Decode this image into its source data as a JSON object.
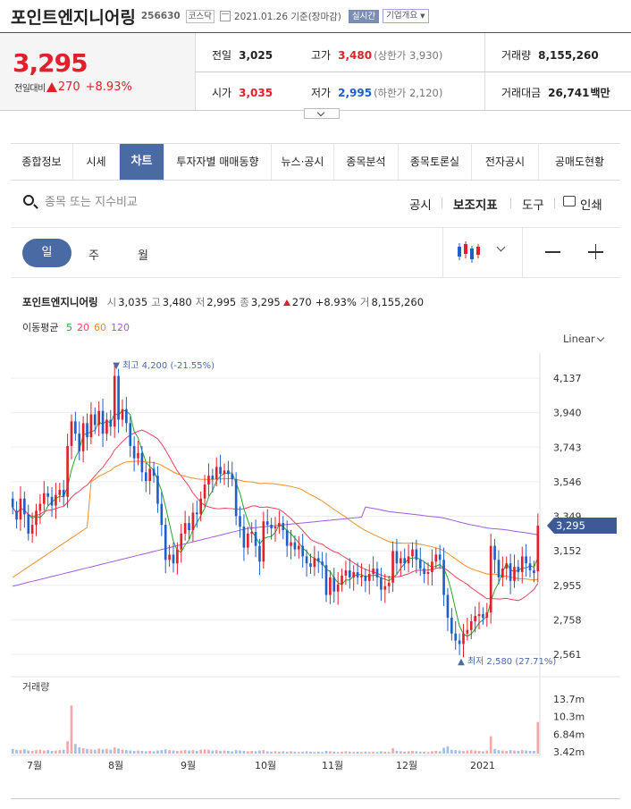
{
  "header": {
    "name": "포인트엔지니어링",
    "code": "256630",
    "market": "코스닥",
    "date": "2021.01.26",
    "basis": "기준(장마감)",
    "realtime": "실시간",
    "company": "기업개요"
  },
  "price": {
    "current": "3,295",
    "change_label": "전일대비",
    "change": "270",
    "change_pct": "+8.93%",
    "color": "#e0202a"
  },
  "stats": {
    "prev_label": "전일",
    "prev": "3,025",
    "high_label": "고가",
    "high": "3,480",
    "upper_limit": "(상한가 3,930)",
    "volume_label": "거래량",
    "volume": "8,155,260",
    "open_label": "시가",
    "open": "3,035",
    "low_label": "저가",
    "low": "2,995",
    "lower_limit": "(하한가 2,120)",
    "amount_label": "거래대금",
    "amount": "26,741",
    "amount_unit": "백만"
  },
  "tabs": [
    "종합정보",
    "시세",
    "차트",
    "투자자별 매매동향",
    "뉴스·공시",
    "종목분석",
    "종목토론실",
    "전자공시",
    "공매도현황"
  ],
  "active_tab": 2,
  "search": {
    "placeholder": "종목 또는 지수비교"
  },
  "tools": {
    "notice": "공시",
    "indicator": "보조지표",
    "tool": "도구",
    "print": "인쇄"
  },
  "periods": {
    "day": "일",
    "week": "주",
    "month": "월"
  },
  "info": {
    "name": "포인트엔지니어링",
    "open_k": "시",
    "open_v": "3,035",
    "high_k": "고",
    "high_v": "3,480",
    "low_k": "저",
    "low_v": "2,995",
    "close_k": "종",
    "close_v": "3,295",
    "chg_v": "270",
    "pct_v": "+8.93%",
    "vol_k": "거",
    "vol_v": "8,155,260"
  },
  "ma": {
    "label": "이동평균",
    "items": [
      {
        "label": "5",
        "color": "#27a52a"
      },
      {
        "label": "20",
        "color": "#f0435c"
      },
      {
        "label": "60",
        "color": "#f0902a"
      },
      {
        "label": "120",
        "color": "#a05be0"
      }
    ]
  },
  "scale": "Linear",
  "price_tag": "3,295",
  "volume_label": "거래량",
  "chart_data": {
    "type": "candlestick",
    "y_ticks": [
      "4,137",
      "3,940",
      "3,743",
      "3,546",
      "3,349",
      "3,152",
      "2,955",
      "2,758",
      "2,561"
    ],
    "ylim": [
      2561,
      4137
    ],
    "x_ticks": [
      "7월",
      "8월",
      "9월",
      "10월",
      "11월",
      "12월",
      "2021"
    ],
    "volume_ticks": [
      "13.7m",
      "10.3m",
      "6.84m",
      "3.42m"
    ],
    "high_annotation": {
      "label": "최고",
      "value": "4,200",
      "pct": "(-21.55%)"
    },
    "low_annotation": {
      "label": "최저",
      "value": "2,580",
      "pct": "(27.71%)"
    },
    "up_color": "#e0202a",
    "down_color": "#1e5fc8",
    "close": [
      3400,
      3330,
      3450,
      3360,
      3250,
      3300,
      3380,
      3420,
      3480,
      3460,
      3410,
      3470,
      3500,
      3460,
      3750,
      3890,
      3820,
      3720,
      3880,
      3800,
      3930,
      3870,
      3950,
      3820,
      3900,
      3860,
      4150,
      3900,
      3960,
      3880,
      3750,
      3680,
      3710,
      3600,
      3550,
      3620,
      3580,
      3420,
      3300,
      3100,
      3130,
      3080,
      3160,
      3250,
      3310,
      3270,
      3370,
      3360,
      3450,
      3530,
      3580,
      3560,
      3630,
      3590,
      3610,
      3590,
      3560,
      3350,
      3290,
      3170,
      3250,
      3260,
      3180,
      3090,
      3320,
      3300,
      3280,
      3290,
      3310,
      3270,
      3180,
      3200,
      3160,
      3180,
      3120,
      3080,
      3060,
      3110,
      3090,
      3070,
      2900,
      3000,
      2920,
      2960,
      3010,
      3040,
      3000,
      3030,
      3000,
      3010,
      2980,
      3020,
      3050,
      3000,
      2930,
      2950,
      2970,
      3150,
      3080,
      3110,
      3080,
      3120,
      3160,
      3100,
      3050,
      3020,
      3030,
      3090,
      3130,
      3100,
      2900,
      2770,
      2680,
      2640,
      2620,
      2680,
      2700,
      2750,
      2780,
      2790,
      2770,
      2800,
      3180,
      3100,
      3000,
      3050,
      3080,
      2980,
      3060,
      3030,
      3120,
      3080,
      3040,
      3025,
      3295
    ],
    "open": [
      3450,
      3380,
      3330,
      3450,
      3360,
      3250,
      3300,
      3380,
      3420,
      3480,
      3460,
      3410,
      3470,
      3500,
      3460,
      3750,
      3890,
      3820,
      3720,
      3880,
      3800,
      3930,
      3870,
      3950,
      3820,
      3900,
      3860,
      4150,
      3900,
      3960,
      3880,
      3750,
      3680,
      3710,
      3600,
      3550,
      3620,
      3580,
      3420,
      3300,
      3100,
      3130,
      3080,
      3160,
      3250,
      3310,
      3270,
      3370,
      3360,
      3450,
      3530,
      3580,
      3560,
      3630,
      3590,
      3610,
      3590,
      3560,
      3350,
      3290,
      3170,
      3250,
      3260,
      3180,
      3090,
      3320,
      3300,
      3280,
      3290,
      3310,
      3270,
      3180,
      3200,
      3160,
      3180,
      3120,
      3080,
      3060,
      3110,
      3090,
      3070,
      2900,
      3000,
      2920,
      2960,
      3010,
      3040,
      3000,
      3030,
      3000,
      3010,
      2980,
      3020,
      3050,
      3000,
      2930,
      2950,
      2970,
      3150,
      3080,
      3110,
      3080,
      3120,
      3160,
      3100,
      3050,
      3020,
      3030,
      3090,
      3130,
      3100,
      2900,
      2770,
      2680,
      2640,
      2620,
      2680,
      2700,
      2750,
      2780,
      2790,
      2770,
      2800,
      3180,
      3100,
      3000,
      3050,
      3080,
      2980,
      3060,
      3030,
      3120,
      3080,
      3040,
      3035
    ],
    "volume": [
      1.2,
      1.0,
      0.9,
      1.1,
      0.8,
      0.7,
      0.9,
      1.0,
      0.8,
      0.9,
      0.7,
      0.8,
      0.9,
      1.0,
      3.2,
      12.5,
      2.5,
      1.6,
      1.4,
      1.2,
      1.1,
      1.0,
      1.3,
      1.1,
      1.2,
      1.0,
      1.6,
      1.3,
      1.0,
      0.9,
      0.8,
      0.7,
      0.8,
      0.7,
      0.6,
      0.7,
      0.6,
      0.8,
      0.9,
      1.1,
      0.9,
      0.8,
      0.7,
      0.8,
      0.9,
      0.8,
      0.9,
      0.7,
      1.0,
      1.1,
      1.0,
      0.8,
      0.9,
      0.7,
      0.8,
      0.7,
      0.6,
      0.9,
      0.8,
      0.7,
      0.6,
      0.7,
      0.6,
      0.8,
      0.9,
      0.6,
      0.5,
      0.6,
      0.5,
      0.6,
      0.5,
      0.6,
      0.5,
      0.4,
      0.5,
      0.6,
      0.5,
      0.4,
      0.5,
      0.4,
      0.7,
      0.6,
      0.5,
      0.4,
      0.5,
      0.6,
      0.5,
      0.4,
      0.5,
      0.4,
      0.5,
      0.4,
      0.5,
      0.4,
      0.6,
      0.5,
      0.4,
      1.4,
      0.7,
      0.6,
      0.5,
      0.6,
      0.7,
      0.6,
      0.5,
      0.5,
      0.4,
      0.6,
      0.7,
      0.6,
      1.5,
      1.9,
      1.0,
      0.9,
      0.8,
      0.7,
      0.8,
      0.9,
      0.8,
      0.7,
      0.6,
      0.8,
      4.5,
      1.2,
      0.9,
      0.8,
      0.7,
      0.9,
      0.8,
      0.7,
      0.9,
      0.8,
      0.7,
      0.7,
      8.2
    ]
  }
}
